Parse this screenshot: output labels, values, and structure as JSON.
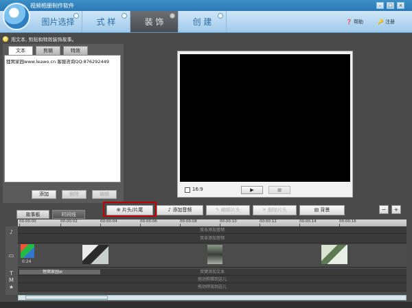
{
  "app": {
    "title": "视频相册制作软件"
  },
  "window": {
    "minimize": "–",
    "maximize": "□",
    "close": "×"
  },
  "nav": {
    "tabs": [
      {
        "label": "图片选择"
      },
      {
        "label": "式 样"
      },
      {
        "label": "装 饰"
      },
      {
        "label": "创 建"
      }
    ],
    "help": "帮助",
    "register": "注册"
  },
  "hint": "用文本, 剪贴和特效装饰故事。",
  "left_panel": {
    "tabs": [
      "文本",
      "剪辑",
      "特效"
    ],
    "items": [
      "狸窝家园www.leawo.cn 客服咨询QQ:876292449"
    ],
    "buttons": {
      "add": "添加",
      "delete": "删除",
      "edit": "编辑"
    }
  },
  "preview": {
    "ratio": "16:9",
    "play": "▶",
    "stop": "■"
  },
  "timeline": {
    "tabs": [
      "故事板",
      "时间线"
    ],
    "tools": {
      "intro_outro": "片头/片尾",
      "add_audio": "添加音频",
      "edit_intro": "编辑片头",
      "delete_intro": "删除片头",
      "background": "背景"
    },
    "zoom_out": "−",
    "zoom_in": "+",
    "ruler": [
      "00:00:00",
      "00:00:02",
      "00:00:04",
      "00:00:06",
      "00:00:08",
      "00:00:10",
      "00:00:12",
      "00:00:14",
      "00:00:16"
    ],
    "tracks": {
      "audio1": "双击添加音频",
      "audio2": "双击添加音频",
      "clip_time": "0:24",
      "text_clip": "狸窝家园w",
      "text": "双键添加文本",
      "clipart": "拖动剪辑到这儿",
      "effects": "拖动特效到这儿"
    }
  }
}
